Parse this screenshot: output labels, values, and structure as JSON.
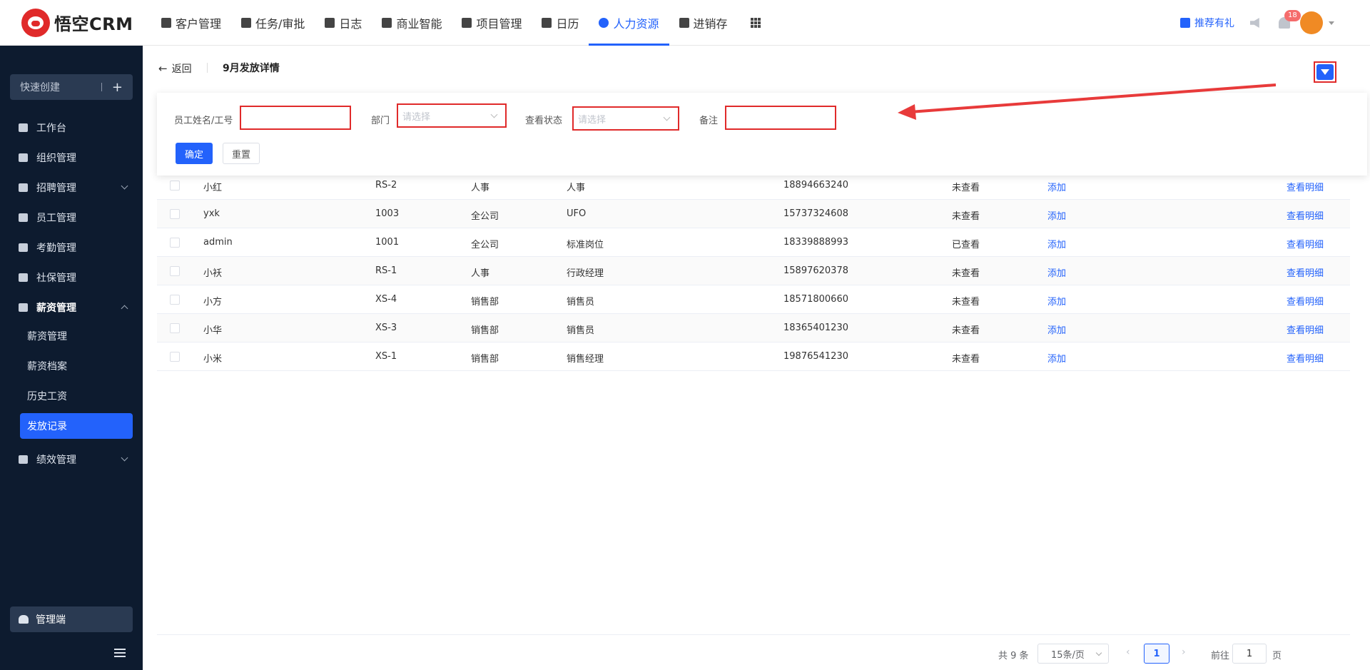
{
  "app": {
    "logo_text": "悟空CRM"
  },
  "topnav": {
    "items": [
      {
        "label": "客户管理",
        "icon": "building-icon"
      },
      {
        "label": "任务/审批",
        "icon": "briefcase-icon"
      },
      {
        "label": "日志",
        "icon": "notebook-icon"
      },
      {
        "label": "商业智能",
        "icon": "shield-check-icon"
      },
      {
        "label": "项目管理",
        "icon": "list-icon"
      },
      {
        "label": "日历",
        "icon": "calendar-icon"
      },
      {
        "label": "人力资源",
        "icon": "people-icon",
        "active": true
      },
      {
        "label": "进销存",
        "icon": "truck-icon"
      }
    ],
    "gift_label": "推荐有礼",
    "notification_count": "18",
    "accent_color": "#2362fb"
  },
  "sidebar": {
    "quick_create": "快速创建",
    "items": [
      {
        "label": "工作台"
      },
      {
        "label": "组织管理"
      },
      {
        "label": "招聘管理"
      },
      {
        "label": "员工管理"
      },
      {
        "label": "考勤管理"
      },
      {
        "label": "社保管理"
      },
      {
        "label": "薪资管理"
      }
    ],
    "sub_items": [
      {
        "label": "薪资管理"
      },
      {
        "label": "薪资档案"
      },
      {
        "label": "历史工资"
      },
      {
        "label": "发放记录",
        "active": true
      }
    ],
    "perf": "绩效管理",
    "admin": "管理端"
  },
  "page": {
    "back": "返回",
    "title": "9月发放详情"
  },
  "filter": {
    "name_label": "员工姓名/工号",
    "dept_label": "部门",
    "dept_placeholder": "请选择",
    "status_label": "查看状态",
    "status_placeholder": "请选择",
    "remark_label": "备注",
    "ok": "确定",
    "reset": "重置"
  },
  "table": {
    "rows": [
      {
        "name": "小红",
        "id": "RS-2",
        "dept": "人事",
        "post": "人事",
        "phone": "18894663240",
        "status": "未查看",
        "action": "添加",
        "detail": "查看明细"
      },
      {
        "name": "yxk",
        "id": "1003",
        "dept": "全公司",
        "post": "UFO",
        "phone": "15737324608",
        "status": "未查看",
        "action": "添加",
        "detail": "查看明细"
      },
      {
        "name": "admin",
        "id": "1001",
        "dept": "全公司",
        "post": "标准岗位",
        "phone": "18339888993",
        "status": "已查看",
        "action": "添加",
        "detail": "查看明细"
      },
      {
        "name": "小袄",
        "id": "RS-1",
        "dept": "人事",
        "post": "行政经理",
        "phone": "15897620378",
        "status": "未查看",
        "action": "添加",
        "detail": "查看明细"
      },
      {
        "name": "小方",
        "id": "XS-4",
        "dept": "销售部",
        "post": "销售员",
        "phone": "18571800660",
        "status": "未查看",
        "action": "添加",
        "detail": "查看明细"
      },
      {
        "name": "小华",
        "id": "XS-3",
        "dept": "销售部",
        "post": "销售员",
        "phone": "18365401230",
        "status": "未查看",
        "action": "添加",
        "detail": "查看明细"
      },
      {
        "name": "小米",
        "id": "XS-1",
        "dept": "销售部",
        "post": "销售经理",
        "phone": "19876541230",
        "status": "未查看",
        "action": "添加",
        "detail": "查看明细"
      }
    ]
  },
  "pager": {
    "total": "共 9 条",
    "page_size": "15条/页",
    "current": "1",
    "goto": "前往",
    "goto_value": "1",
    "unit": "页"
  }
}
